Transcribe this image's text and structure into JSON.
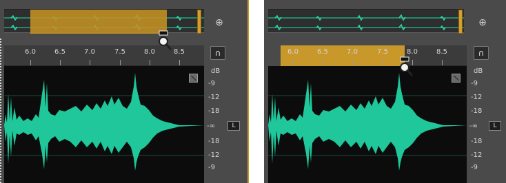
{
  "ruler_left": {
    "labels": [
      "6.0",
      "6.5",
      "7.0",
      "7.5",
      "8.0",
      "8.5"
    ]
  },
  "ruler_right": {
    "labels": [
      "6.0",
      "6.5",
      "7.0",
      "7.5",
      "8.0",
      "8.5"
    ]
  },
  "db_scale": {
    "labels": [
      "dB",
      "-9",
      "-12",
      "-18",
      "-∞",
      "-18",
      "-12",
      "-9"
    ]
  },
  "channel_button": "L",
  "icons": {
    "zoom": "magnifier-icon",
    "headphones": "headphones-icon",
    "tool": "waveform-tool-icon",
    "cursor": "zoom-drag-cursor-icon"
  },
  "colors": {
    "waveform": "#1fc79a",
    "selection": "#c9982b",
    "panel": "#4a4a4a",
    "background": "#0c0c0c"
  }
}
